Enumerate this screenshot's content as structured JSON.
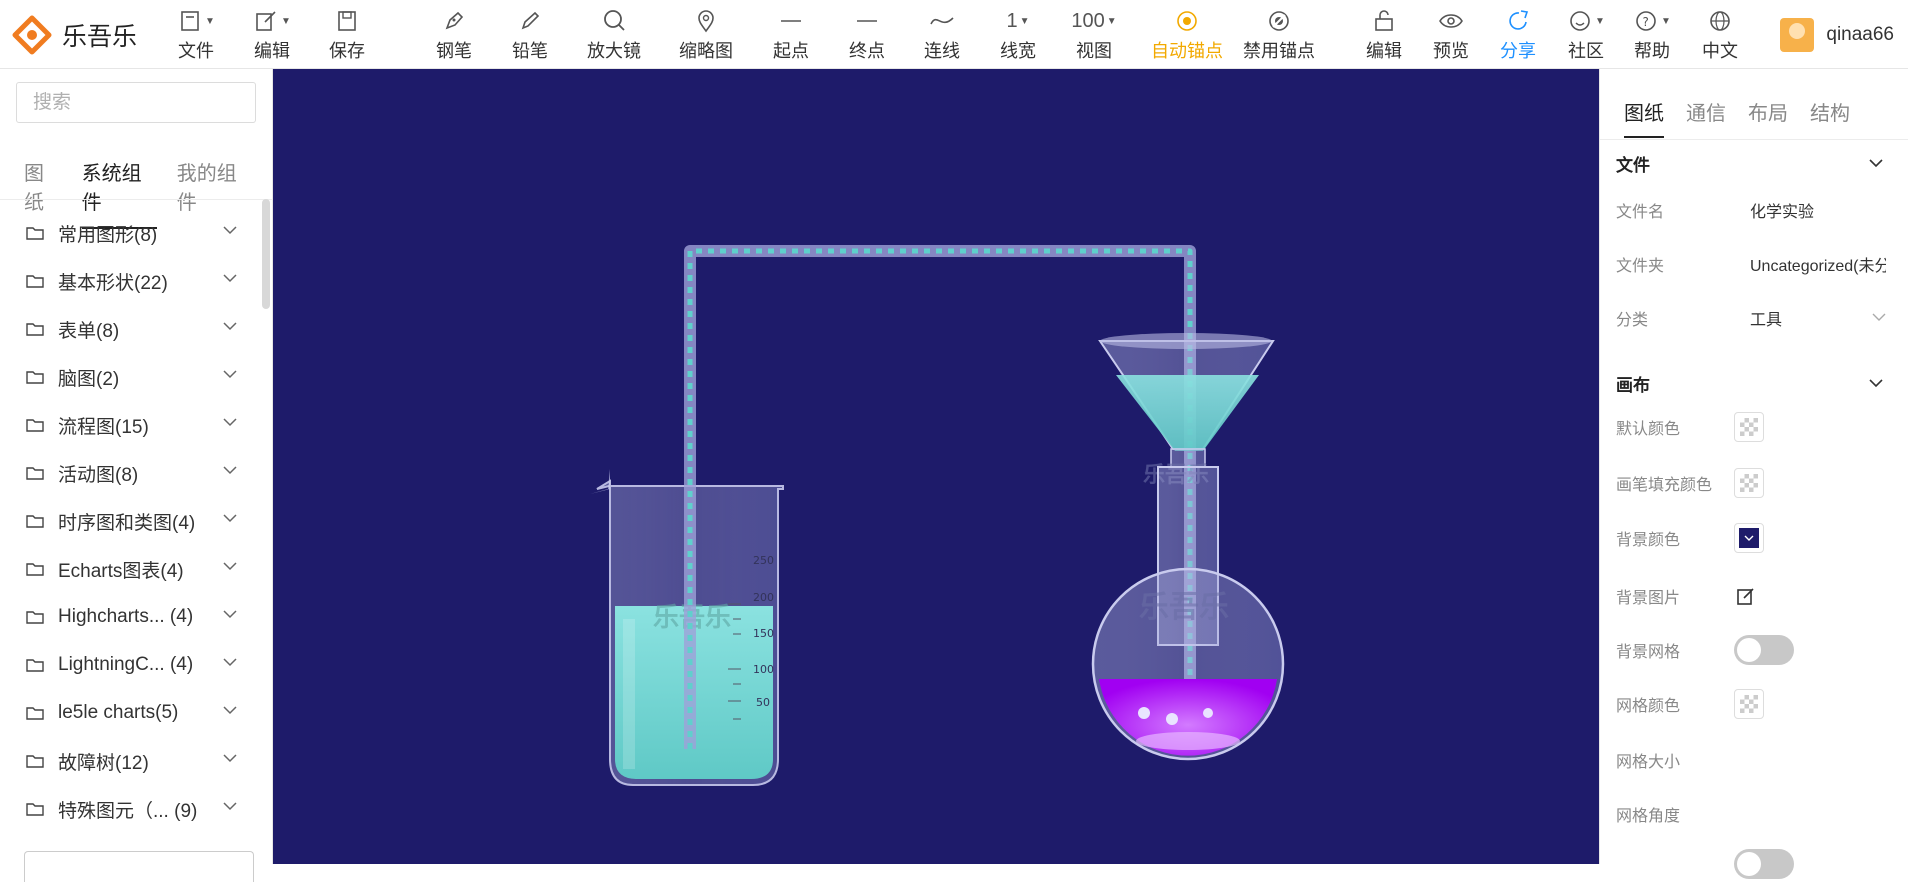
{
  "app": {
    "name": "乐吾乐"
  },
  "toolbar": {
    "file": "文件",
    "edit": "编辑",
    "save": "保存",
    "pen": "钢笔",
    "pencil": "铅笔",
    "magnifier": "放大镜",
    "thumbnail": "缩略图",
    "start": "起点",
    "end": "终点",
    "connect": "连线",
    "line_width_value": "1",
    "line_width": "线宽",
    "zoom_value": "100",
    "view": "视图",
    "auto_anchor": "自动锚点",
    "disable_anchor": "禁用锚点",
    "edit2": "编辑",
    "preview": "预览",
    "share": "分享",
    "community": "社区",
    "help": "帮助",
    "language": "中文"
  },
  "user": {
    "name": "qinaa66"
  },
  "left": {
    "search_placeholder": "搜索",
    "tabs": [
      "图纸",
      "系统组件",
      "我的组件"
    ],
    "categories": [
      "常用图形(8)",
      "基本形状(22)",
      "表单(8)",
      "脑图(2)",
      "流程图(15)",
      "活动图(8)",
      "时序图和类图(4)",
      "Echarts图表(4)",
      "Highcharts...  (4)",
      "LightningC...  (4)",
      "le5le charts(5)",
      "故障树(12)",
      "特殊图元（...  (9)"
    ]
  },
  "canvas": {
    "background": "#1e1b6a",
    "watermark": "乐吾乐",
    "beaker_marks": [
      "250",
      "200",
      "150",
      "100",
      "50"
    ]
  },
  "right": {
    "tabs": [
      "图纸",
      "通信",
      "布局",
      "结构"
    ],
    "file_section": "文件",
    "file_name_label": "文件名",
    "file_name_value": "化学实验",
    "folder_label": "文件夹",
    "folder_value": "Uncategorized(未分",
    "category_label": "分类",
    "category_value": "工具",
    "canvas_section": "画布",
    "default_color": "默认颜色",
    "pen_fill_color": "画笔填充颜色",
    "bg_color": "背景颜色",
    "bg_image": "背景图片",
    "bg_grid": "背景网格",
    "grid_color": "网格颜色",
    "grid_size": "网格大小",
    "grid_angle": "网格角度"
  },
  "colors": {
    "accent_active": "#f2a900",
    "share_blue": "#1e90ff",
    "canvas_bg": "#1e1b6a"
  }
}
